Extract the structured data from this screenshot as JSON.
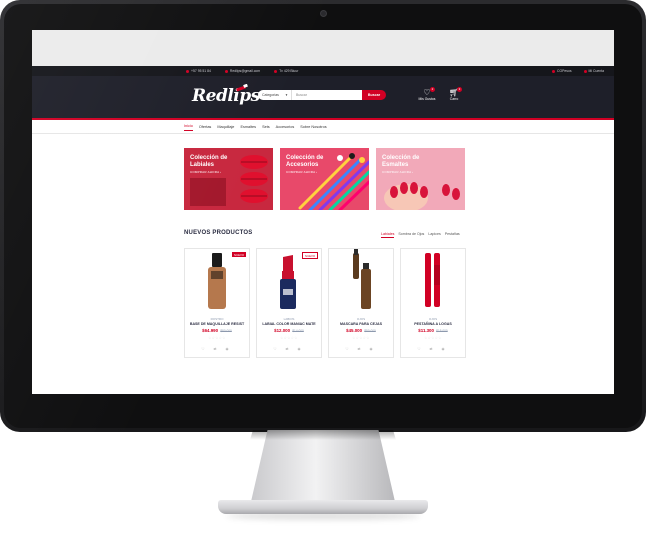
{
  "topbar": {
    "phone": "+57 95 51 84",
    "email": "Redlips@gmail.com",
    "address": "Tv 429 Bluur",
    "currency": "COPesos",
    "account": "Mi Cuenta"
  },
  "header": {
    "logo": "Redlips",
    "search_category": "Categorias",
    "search_placeholder": "Buscar",
    "search_button": "Buscar",
    "wishlist_label": "Mis Gustos",
    "wishlist_count": "2",
    "cart_label": "Carro",
    "cart_count": "3"
  },
  "nav": {
    "items": [
      "Inicio",
      "Ofertas",
      "Maquillaje",
      "Esmaltes",
      "Sets",
      "Accesorios",
      "Sobre Nosotros"
    ]
  },
  "banners": [
    {
      "title": "Colección de Labiales",
      "cta": "COMPRAR AHORA ›"
    },
    {
      "title": "Colección de Accesorios",
      "cta": "COMPRAR AHORA ›"
    },
    {
      "title": "Colección de Esmaltes",
      "cta": "COMPRAR AHORA ›"
    }
  ],
  "section": {
    "title": "NUEVOS PRODUCTOS",
    "tabs": [
      "Labiales",
      "Sombra de Ojos",
      "Lapices",
      "Pestañas"
    ]
  },
  "products": [
    {
      "badge": "NUEVO",
      "category": "ROSTRO",
      "name": "BASE DE MAQUILLAJE RESIST",
      "price": "$64.990",
      "old_price": "$80.000",
      "stars": "☆☆☆☆☆",
      "actions": "♡ ⇄ ◉"
    },
    {
      "badge": "NUEVO",
      "category": "LABIOS",
      "name": "LABIAL COLOR MANIAC MATE",
      "price": "$12.000",
      "old_price": "$14.000",
      "stars": "☆☆☆☆☆",
      "actions": "♡ ⇄ ◉"
    },
    {
      "badge": "",
      "category": "OJOS",
      "name": "MASCARA PARA CEJAS",
      "price": "$45.000",
      "old_price": "$50.000",
      "stars": "☆☆☆☆☆",
      "actions": "♡ ⇄ ◉"
    },
    {
      "badge": "",
      "category": "OJOS",
      "name": "PESTAÑINA A LOGAS",
      "price": "$11.300",
      "old_price": "$15.000",
      "stars": "☆☆☆☆☆",
      "actions": "♡ ⇄ ◉"
    }
  ],
  "colors": {
    "brand_red": "#d10024",
    "header_dark": "#1e1f29",
    "topbar_dark": "#15161b"
  }
}
